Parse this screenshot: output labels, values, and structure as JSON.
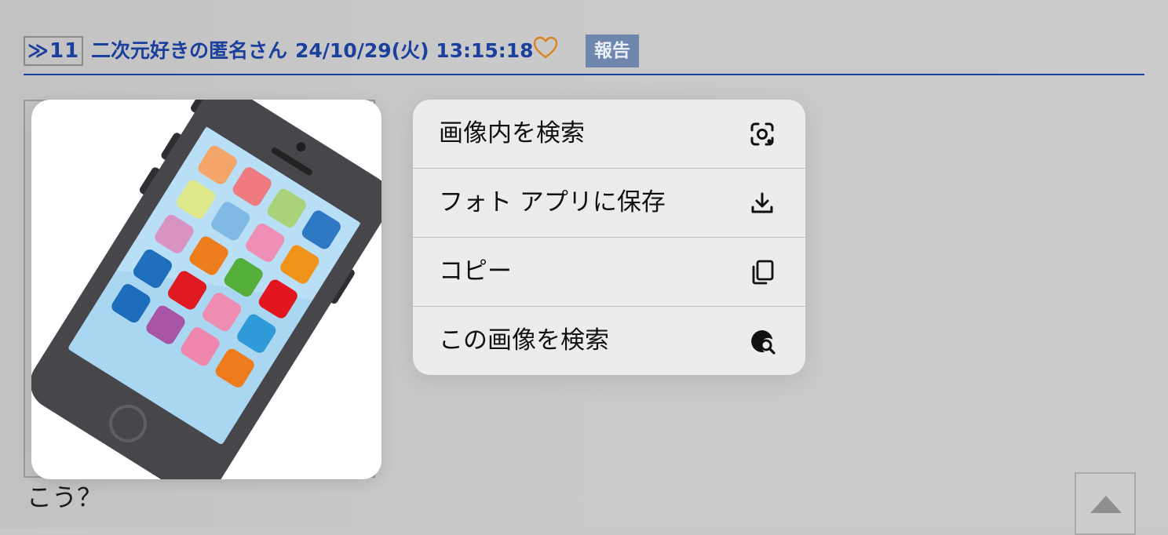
{
  "post": {
    "res_number": "≫11",
    "poster_name": "二次元好きの匿名さん",
    "date": "24/10/29(火) 13:15:18",
    "report_label": "報告",
    "body_text": "こう？"
  },
  "context_menu": {
    "items": [
      {
        "label": "画像内を検索",
        "icon": "visual-lookup-icon"
      },
      {
        "label": "フォト アプリに保存",
        "icon": "download-icon"
      },
      {
        "label": "コピー",
        "icon": "copy-icon"
      },
      {
        "label": "この画像を検索",
        "icon": "image-search-icon"
      }
    ]
  },
  "colors": {
    "link_blue": "#1a3f9c",
    "heart_orange": "#d9831f",
    "report_bg": "#6f86ad",
    "menu_bg": "#ececec",
    "page_bg": "#c8c8c8"
  }
}
